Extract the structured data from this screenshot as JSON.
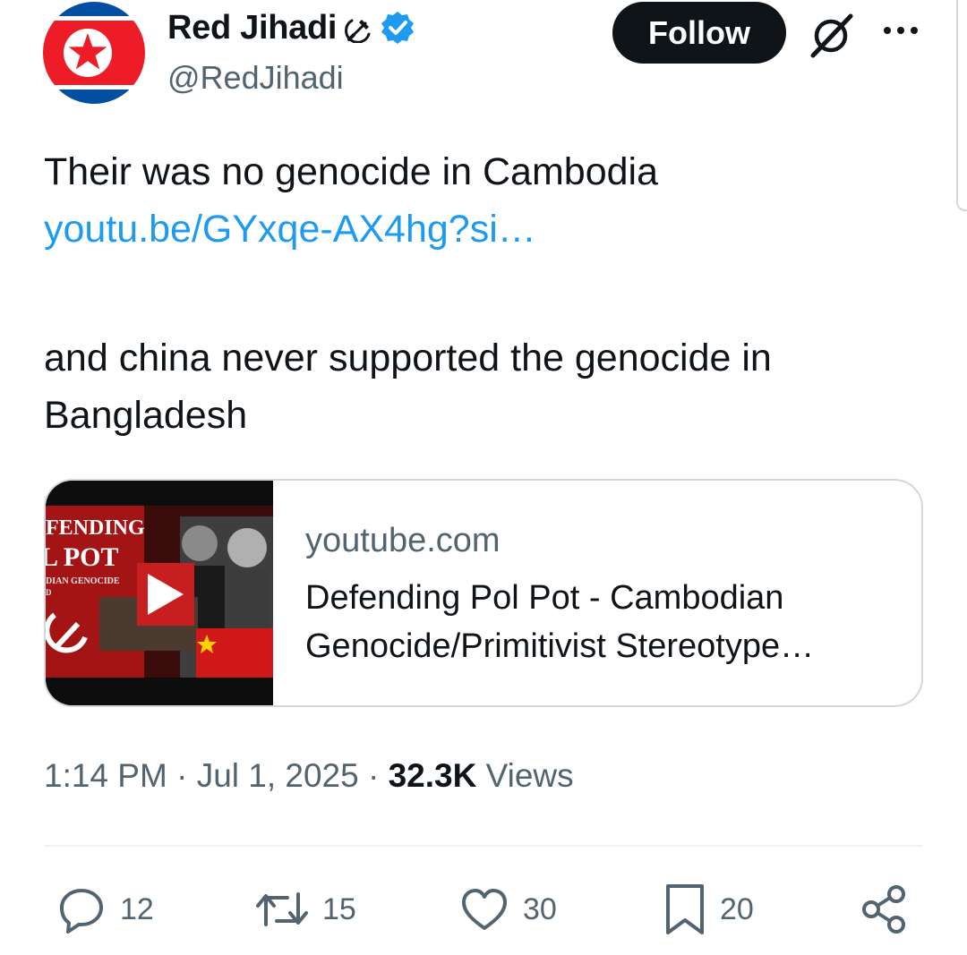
{
  "author": {
    "display_name": "Red Jihadi",
    "name_emoji": "hammer-and-sickle",
    "verified_icon": "verified-badge-icon",
    "handle": "@RedJihadi",
    "avatar": "north-korea-flag-avatar"
  },
  "header": {
    "follow_label": "Follow",
    "grok_icon": "grok-icon",
    "more_icon": "more-icon"
  },
  "tweet": {
    "line1": "Their was no genocide in Cambodia",
    "link": "youtu.be/GYxqe-AX4hg?si…",
    "line2": "and china never supported the genocide in Bangladesh"
  },
  "card": {
    "domain": "youtube.com",
    "title": "Defending Pol Pot - Cambodian Genocide/Primitivist Stereotype…",
    "thumbnail_text": {
      "line1": "FENDING",
      "line2": "L POT",
      "line3": "DIAN GENOCIDE",
      "line4": "D"
    }
  },
  "meta": {
    "time": "1:14 PM",
    "sep1": "·",
    "date": "Jul 1, 2025",
    "sep2": "·",
    "views_count": "32.3K",
    "views_label": "Views"
  },
  "actions": {
    "replies": "12",
    "reposts": "15",
    "likes": "30",
    "bookmarks": "20"
  },
  "colors": {
    "text": "#0f1419",
    "secondary": "#536471",
    "link": "#1d9bf0",
    "border": "#cfd9de",
    "follow_bg": "#0f1419"
  }
}
